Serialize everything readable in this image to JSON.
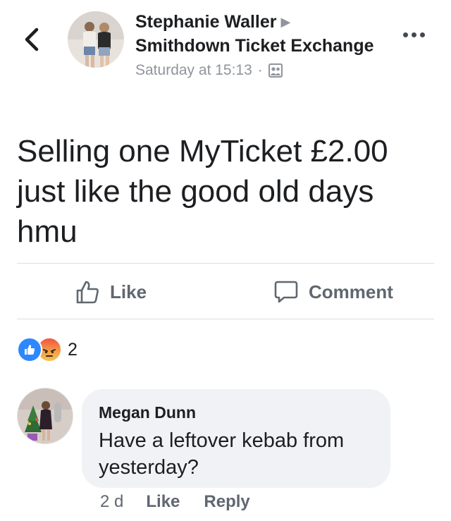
{
  "post": {
    "author": "Stephanie Waller",
    "group": "Smithdown Ticket Exchange",
    "timestamp": "Saturday at 15:13",
    "separator": "·",
    "privacy_icon": "group-icon",
    "text": "Selling one MyTicket £2.00\njust like the good old days\nhmu"
  },
  "actions": {
    "like_label": "Like",
    "comment_label": "Comment"
  },
  "reactions": {
    "types": [
      "like",
      "angry"
    ],
    "count": "2"
  },
  "comment": {
    "author": "Megan Dunn",
    "text": "Have a leftover kebab from yesterday?",
    "time": "2 d",
    "like_label": "Like",
    "reply_label": "Reply"
  },
  "colors": {
    "like_blue": "#2d88ff",
    "secondary_text": "#606770",
    "meta_text": "#90949c",
    "bubble_bg": "#f0f2f5"
  }
}
